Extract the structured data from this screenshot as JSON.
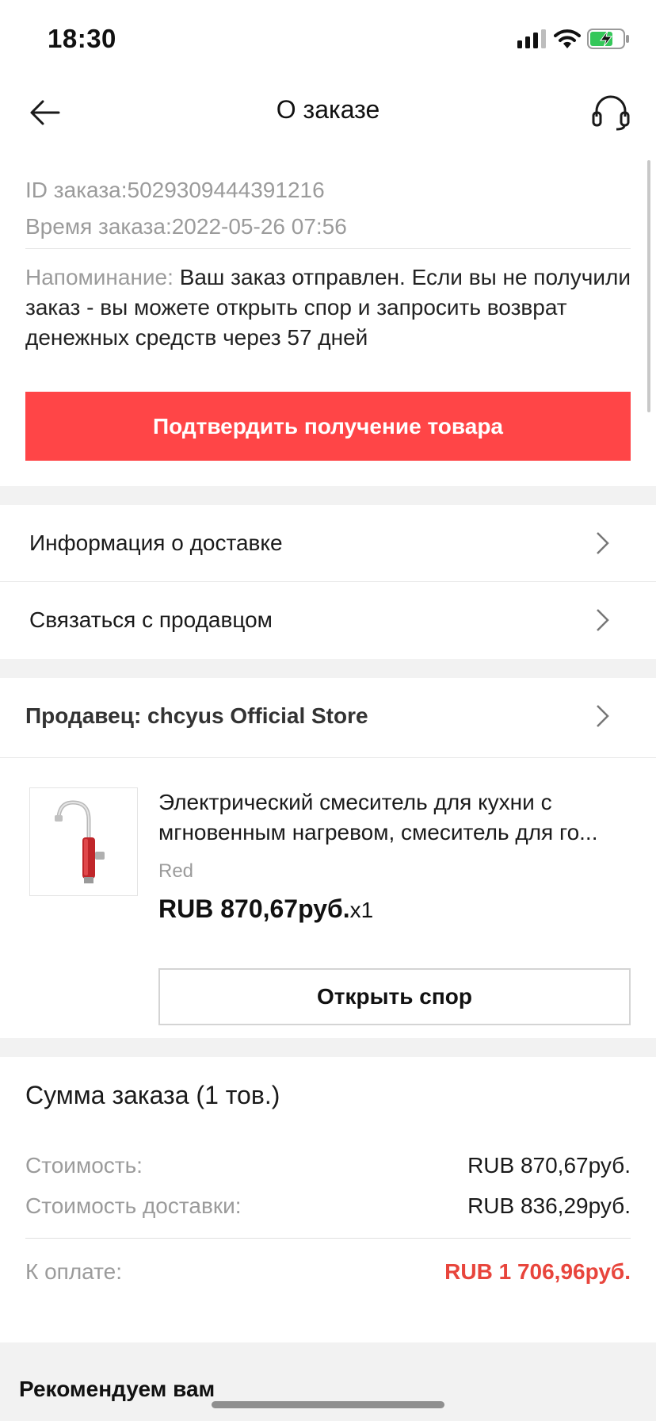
{
  "status_bar": {
    "time": "18:30"
  },
  "header": {
    "title": "О заказе"
  },
  "order": {
    "id_text": "ID заказа:5029309444391216",
    "time_text": "Время заказа:2022-05-26 07:56",
    "reminder_label": "Напоминание: ",
    "reminder_text": "Ваш заказ отправлен. Если вы не получили заказ - вы можете открыть спор и запросить возврат денежных средств через 57 дней",
    "confirm_button": "Подтвердить получение товара"
  },
  "menu": {
    "delivery_info": "Информация о доставке",
    "contact_seller": "Связаться с продавцом"
  },
  "seller": {
    "label": "Продавец: chcyus Official Store"
  },
  "product": {
    "name": "Электрический смеситель для кухни с мгновенным нагревом, смеситель для го...",
    "variant": "Red",
    "price": "RUB 870,67руб.",
    "quantity": "x1",
    "dispute_button": "Открыть спор"
  },
  "summary": {
    "title": "Сумма заказа (1 тов.)",
    "cost_label": "Стоимость:",
    "cost_value": "RUB 870,67руб.",
    "shipping_label": "Стоимость доставки:",
    "shipping_value": "RUB 836,29руб.",
    "total_label": "К оплате:",
    "total_value": "RUB 1 706,96руб."
  },
  "recommend": {
    "title": "Рекомендуем вам"
  },
  "colors": {
    "accent": "#ff4547",
    "total": "#e8453c",
    "background_gap": "#f2f2f2"
  },
  "icons": [
    "signal-icon",
    "wifi-icon",
    "battery-charging-icon",
    "back-arrow-icon",
    "headset-icon",
    "chevron-right-icon"
  ]
}
